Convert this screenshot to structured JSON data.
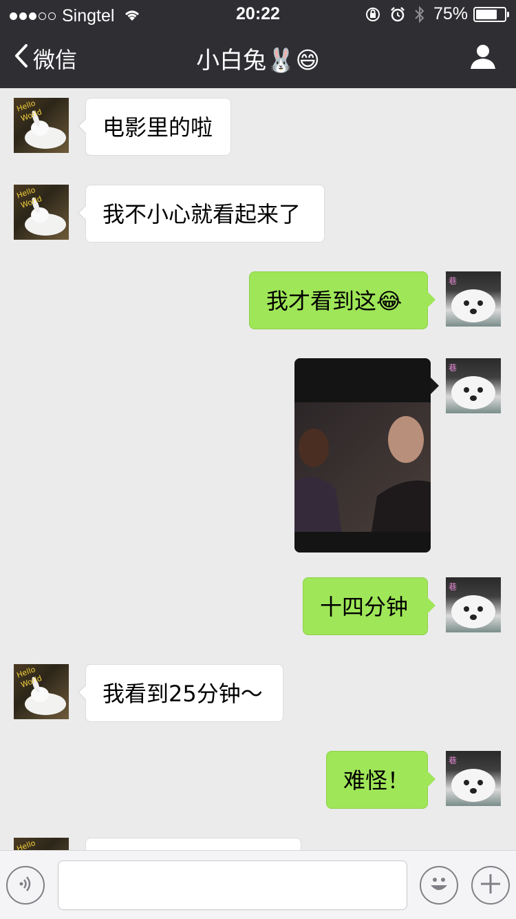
{
  "status_bar": {
    "carrier": "Singtel",
    "time": "20:22",
    "battery": "75%",
    "signal_bars": 3,
    "signal_total": 5,
    "battery_level": 0.75
  },
  "nav": {
    "back_label": "微信",
    "title": "小白兔🐰😄"
  },
  "messages": [
    {
      "side": "in",
      "text": "电影里的啦"
    },
    {
      "side": "in",
      "text": "我不小心就看起来了"
    },
    {
      "side": "out",
      "text": "我才看到这😂"
    },
    {
      "side": "out",
      "type": "image"
    },
    {
      "side": "out",
      "text": "十四分钟"
    },
    {
      "side": "in",
      "text": "我看到25分钟～"
    },
    {
      "side": "out",
      "text": "难怪！"
    },
    {
      "side": "in",
      "text": ""
    }
  ],
  "input": {
    "placeholder": ""
  },
  "colors": {
    "nav_bg": "#2e2e33",
    "chat_bg": "#ebebeb",
    "outgoing_bubble": "#9fe658",
    "incoming_bubble": "#ffffff"
  },
  "icons": [
    "wifi-icon",
    "lock-rotation-icon",
    "alarm-icon",
    "bluetooth-icon",
    "back-chevron-icon",
    "profile-icon",
    "voice-icon",
    "emoji-icon",
    "plus-icon"
  ]
}
